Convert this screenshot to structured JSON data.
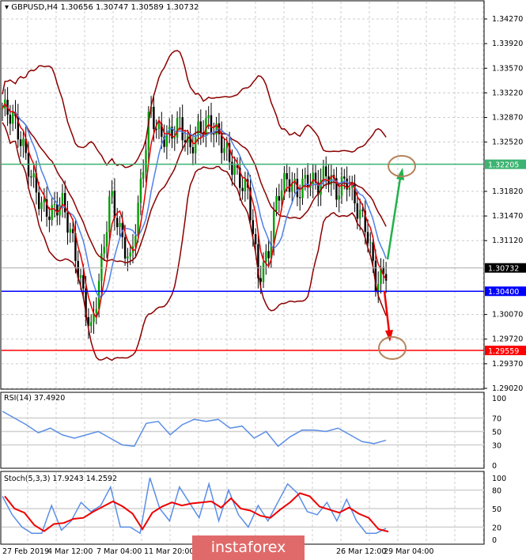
{
  "header": {
    "symbol": "GBPUSD,H4",
    "ohlc": "1.30656 1.30747 1.30589 1.30732"
  },
  "price_axis": [
    "1.34270",
    "1.33920",
    "1.33570",
    "1.33220",
    "1.32870",
    "1.32520",
    "1.31820",
    "1.31470",
    "1.31120",
    "1.30070",
    "1.29720",
    "1.29370",
    "1.29020"
  ],
  "levels": [
    {
      "label": "1.32205",
      "value": 1.32205,
      "color": "#3cb371"
    },
    {
      "label": "1.30732",
      "value": 1.30732,
      "color": "#000000"
    },
    {
      "label": "1.30400",
      "value": 1.304,
      "color": "#0000ff"
    },
    {
      "label": "1.29559",
      "value": 1.29559,
      "color": "#ff0000"
    }
  ],
  "rsi": {
    "title": "RSI(14) 37.4920",
    "axis": [
      "100",
      "70",
      "50",
      "30",
      "0"
    ]
  },
  "stoch": {
    "title": "Stoch(5,3,3) 17.9243 14.2592",
    "axis": [
      "100",
      "80",
      "50",
      "20",
      "0"
    ]
  },
  "time_axis": [
    "27 Feb 2019",
    "4 Mar 12:00",
    "7 Mar 04:00",
    "11 Mar 20:00",
    "26 Mar 12:00",
    "29 Mar 04:00"
  ],
  "brand": "instaforex",
  "chart_data": {
    "type": "line",
    "closes": [
      1.33,
      1.329,
      1.325,
      1.32,
      1.316,
      1.315,
      1.317,
      1.312,
      1.305,
      1.298,
      1.307,
      1.318,
      1.312,
      1.308,
      1.318,
      1.33,
      1.326,
      1.326,
      1.328,
      1.324,
      1.327,
      1.328,
      1.326,
      1.323,
      1.32,
      1.318,
      1.306,
      1.309,
      1.318,
      1.32,
      1.318,
      1.32,
      1.319,
      1.321,
      1.318,
      1.32,
      1.316,
      1.313,
      1.305,
      1.307
    ],
    "rsi": [
      80,
      70,
      60,
      48,
      55,
      45,
      40,
      45,
      50,
      40,
      30,
      28,
      62,
      65,
      45,
      60,
      68,
      65,
      68,
      55,
      58,
      40,
      50,
      28,
      42,
      52,
      52,
      50,
      55,
      45,
      35,
      32,
      37
    ],
    "stoch_main": [
      70,
      40,
      20,
      10,
      10,
      55,
      15,
      30,
      60,
      45,
      55,
      85,
      20,
      20,
      10,
      100,
      50,
      30,
      85,
      60,
      35,
      90,
      30,
      80,
      40,
      20,
      55,
      30,
      60,
      90,
      75,
      45,
      40,
      60,
      30,
      65,
      30,
      10,
      10,
      18
    ],
    "ylim": [
      1.2902,
      1.3427
    ]
  }
}
